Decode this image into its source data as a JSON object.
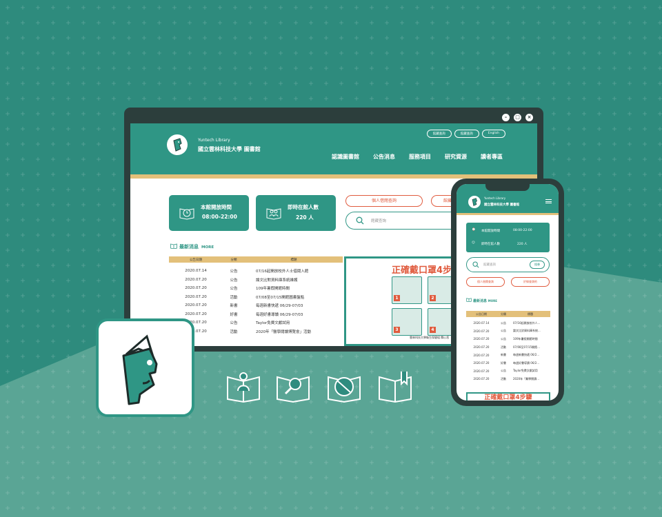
{
  "colors": {
    "teal": "#2f9685",
    "dark": "#2c3e3c",
    "gold": "#e3c07a",
    "orange": "#e05b3e"
  },
  "window": {
    "controls": [
      "minimize-icon",
      "maximize-icon",
      "close-icon"
    ]
  },
  "header": {
    "subtitle": "Yuntech Library",
    "title": "國立雲林科技大學 圖書館",
    "top_links": [
      "館藏查詢",
      "館藏查詢",
      "English"
    ],
    "nav": [
      "認識圖書館",
      "公告消息",
      "服務項目",
      "研究資源",
      "讀者專區"
    ]
  },
  "info": {
    "hours_label": "本館開放時間",
    "hours_value": "08:00-22:00",
    "count_label": "即時在館人數",
    "count_value": "220 人"
  },
  "actions": {
    "personal": "個人借閱查詢",
    "renew": "館藏查詢"
  },
  "search": {
    "placeholder": "館藏查詢"
  },
  "news": {
    "title": "最新消息",
    "more": "MORE",
    "headers": [
      "公告日期",
      "分類",
      "標題"
    ],
    "rows": [
      [
        "2020.07.14",
        "公告",
        "07/16起開放校外人士借閱入館"
      ],
      [
        "2020.07.20",
        "公告",
        "論文比對資料庫系統維護"
      ],
      [
        "2020.07.20",
        "公告",
        "109年暑假開館時間"
      ],
      [
        "2020.07.20",
        "活動",
        "07/08至07/15開館圖書盤點"
      ],
      [
        "2020.07.20",
        "新書",
        "每週新書快遞 06/29-07/03"
      ],
      [
        "2020.07.20",
        "好書",
        "每週好書導讀 06/29-07/03"
      ],
      [
        "2020.07.20",
        "公告",
        "Taylor免費文獻試用"
      ],
      [
        "2020.07.20",
        "活動",
        "2020年「醫學閱讀博覽會」活動"
      ]
    ]
  },
  "poster": {
    "title": "正確戴口罩4步驟",
    "footer": "雲林科技大學衛生保健組 關心您",
    "badges": [
      "1",
      "2",
      "3",
      "4"
    ]
  },
  "phone": {
    "subtitle": "Yuntech Library",
    "title": "國立雲林科技大學 圖書館",
    "hours_label": "本館開放時間",
    "hours_value": "08:00-22:00",
    "count_label": "即時在館人數",
    "count_value": "220 人",
    "search_placeholder": "館藏查詢",
    "search_button": "搜尋",
    "personal": "個人借閱查詢",
    "renew": "於線查詢約",
    "news_title": "最新消息",
    "more": "MORE",
    "headers": [
      "公告日期",
      "分類",
      "標題"
    ],
    "rows": [
      [
        "2020.07.14",
        "公告",
        "07/16起開放校外人..."
      ],
      [
        "2020.07.20",
        "公告",
        "論文比對資料庫系統..."
      ],
      [
        "2020.07.20",
        "公告",
        "109年暑假開館時間"
      ],
      [
        "2020.07.20",
        "活動",
        "07/08至07/15開館..."
      ],
      [
        "2020.07.20",
        "新書",
        "每週新書快遞 06/2..."
      ],
      [
        "2020.07.20",
        "好書",
        "每週好書導讀 06/2..."
      ],
      [
        "2020.07.20",
        "公告",
        "Taylor免費文獻試用"
      ],
      [
        "2020.07.20",
        "活動",
        "2020年「醫學閱讀..."
      ]
    ],
    "poster_title": "正確戴口罩4步驟"
  },
  "feature_icons": [
    "book-person-icon",
    "book-search-icon",
    "book-no-entry-icon",
    "book-bookmark-icon"
  ]
}
